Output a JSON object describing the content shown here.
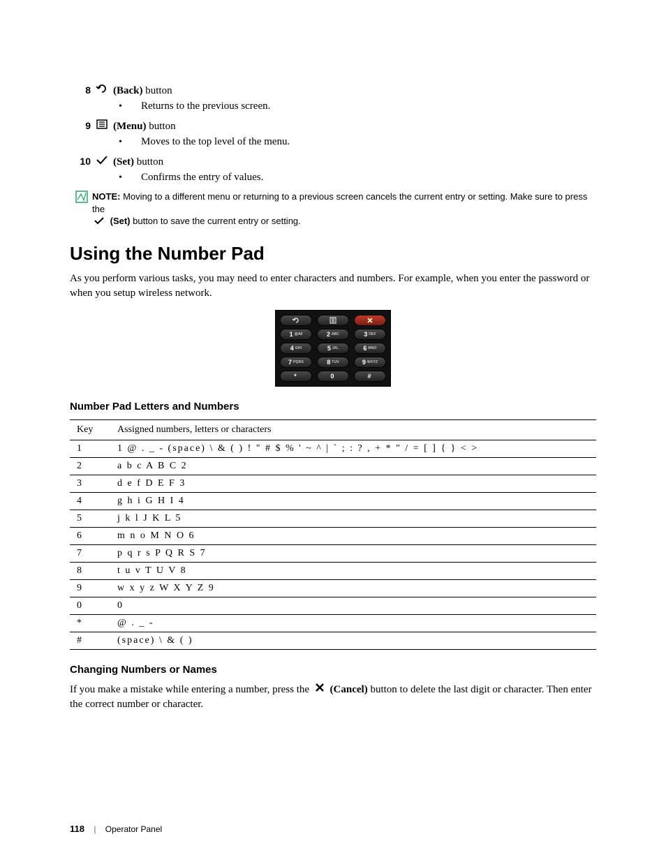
{
  "buttons": {
    "back": {
      "num": "8",
      "label_strong": "(Back)",
      "label_rest": " button",
      "bullet": "Returns to the previous screen."
    },
    "menu": {
      "num": "9",
      "label_strong": "(Menu)",
      "label_rest": " button",
      "bullet": "Moves to the top level of the menu."
    },
    "set": {
      "num": "10",
      "label_strong": "(Set)",
      "label_rest": " button",
      "bullet": "Confirms the entry of values."
    }
  },
  "note": {
    "label": "NOTE:",
    "text1": " Moving to a different menu or returning to a previous screen cancels the current entry or setting. Make sure to press the ",
    "set_strong": "(Set)",
    "text2": " button to save the current entry or setting."
  },
  "section": {
    "heading": "Using the Number Pad",
    "intro": "As you perform various tasks, you may need to enter characters and numbers. For example, when you enter the password or when you setup wireless network."
  },
  "keypad": {
    "rows": [
      [
        {
          "big": "",
          "small": "",
          "icon": "back"
        },
        {
          "big": "",
          "small": "",
          "icon": "menu"
        },
        {
          "big": "",
          "small": "",
          "icon": "x",
          "red": true
        }
      ],
      [
        {
          "big": "1",
          "small": "@A8"
        },
        {
          "big": "2",
          "small": "ABC"
        },
        {
          "big": "3",
          "small": "DEF"
        }
      ],
      [
        {
          "big": "4",
          "small": "GHI"
        },
        {
          "big": "5",
          "small": "JKL"
        },
        {
          "big": "6",
          "small": "MNO"
        }
      ],
      [
        {
          "big": "7",
          "small": "PQRS"
        },
        {
          "big": "8",
          "small": "TUV"
        },
        {
          "big": "9",
          "small": "WXYZ"
        }
      ],
      [
        {
          "big": "*",
          "small": ""
        },
        {
          "big": "0",
          "small": ""
        },
        {
          "big": "#",
          "small": ""
        }
      ]
    ]
  },
  "table": {
    "heading": "Number Pad Letters and Numbers",
    "head_key": "Key",
    "head_assigned": "Assigned numbers, letters or characters",
    "rows": [
      {
        "key": "1",
        "value": "1 @ . _ - (space) \\ & ( ) ! \" # $ % ' ~ ^ | ` ; : ? , + * \" / = [ ] { } < >"
      },
      {
        "key": "2",
        "value": "a b c A B C 2"
      },
      {
        "key": "3",
        "value": "d e f D E F 3"
      },
      {
        "key": "4",
        "value": "g h i G H I 4"
      },
      {
        "key": "5",
        "value": "j k l J K L 5"
      },
      {
        "key": "6",
        "value": "m n o M N O 6"
      },
      {
        "key": "7",
        "value": "p q r s P Q R S 7"
      },
      {
        "key": "8",
        "value": "t u v T U V 8"
      },
      {
        "key": "9",
        "value": "w x y z W X Y Z 9"
      },
      {
        "key": "0",
        "value": "0"
      },
      {
        "key": "*",
        "value": "@ . _ -"
      },
      {
        "key": "#",
        "value": "(space) \\ & ( )"
      }
    ]
  },
  "changing": {
    "heading": "Changing Numbers or Names",
    "text1": "If you make a mistake while entering a number, press the ",
    "cancel_strong": "(Cancel)",
    "text2": " button to delete the last digit or character. Then enter the correct number or character."
  },
  "footer": {
    "page": "118",
    "section": "Operator Panel"
  }
}
